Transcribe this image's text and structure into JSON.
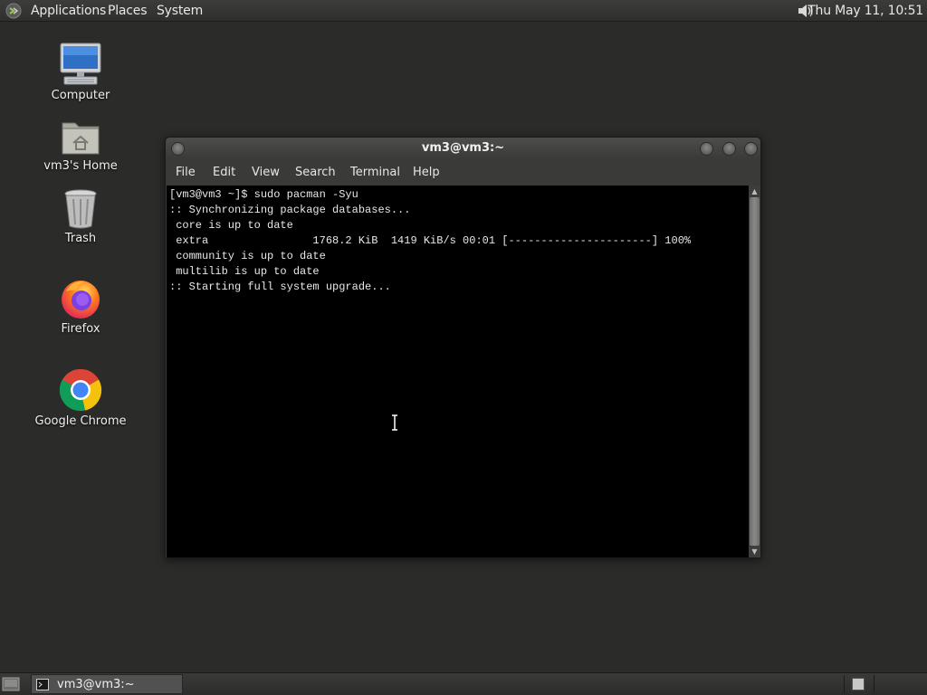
{
  "top_panel": {
    "menus": {
      "applications": "Applications",
      "places": "Places",
      "system": "System"
    },
    "clock": "Thu May 11, 10:51"
  },
  "desktop_icons": {
    "computer": "Computer",
    "home": "vm3's Home",
    "trash": "Trash",
    "firefox": "Firefox",
    "chrome": "Google Chrome"
  },
  "terminal_window": {
    "title": "vm3@vm3:~",
    "menubar": {
      "file": "File",
      "edit": "Edit",
      "view": "View",
      "search": "Search",
      "terminal": "Terminal",
      "help": "Help"
    },
    "output": "[vm3@vm3 ~]$ sudo pacman -Syu\n:: Synchronizing package databases...\n core is up to date\n extra                1768.2 KiB  1419 KiB/s 00:01 [----------------------] 100%\n community is up to date\n multilib is up to date\n:: Starting full system upgrade..."
  },
  "taskbar": {
    "tasks": [
      {
        "label": "vm3@vm3:~"
      }
    ]
  },
  "colors": {
    "desktop_bg": "#2b2c2a",
    "terminal_bg": "#000000",
    "terminal_fg": "#e8e8e8"
  }
}
